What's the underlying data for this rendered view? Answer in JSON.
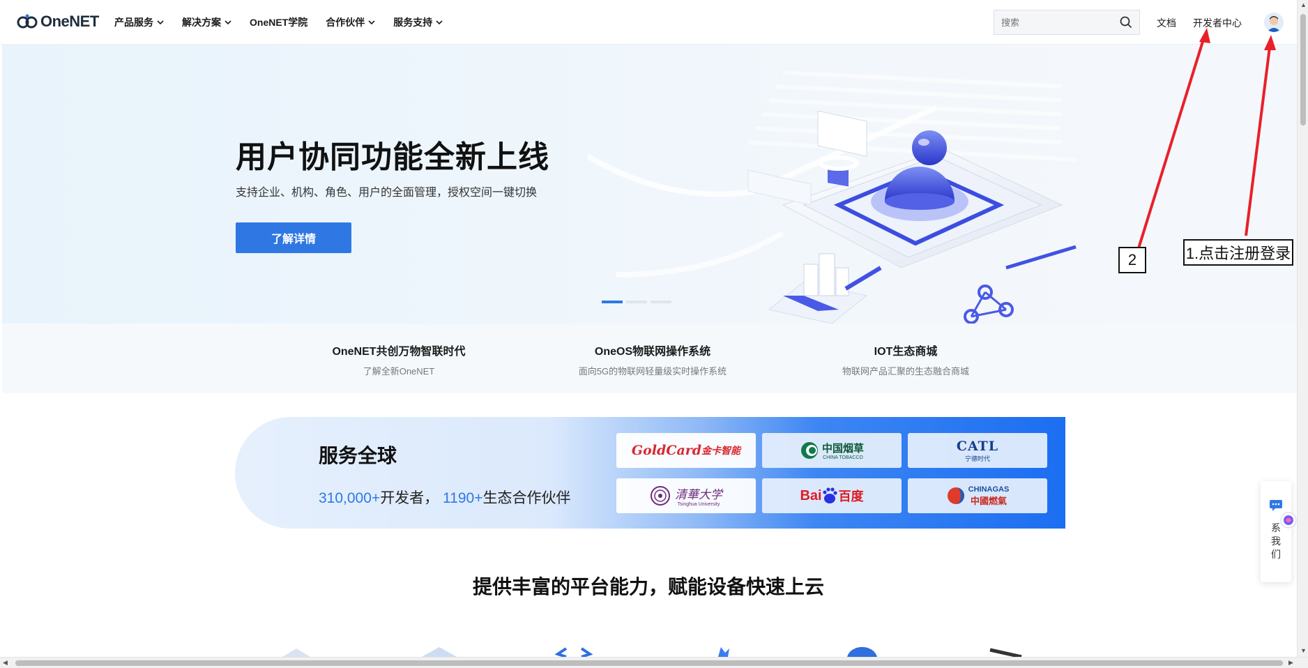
{
  "header": {
    "logo_text": "OneNET",
    "nav": [
      {
        "label": "产品服务",
        "dropdown": true
      },
      {
        "label": "解决方案",
        "dropdown": true
      },
      {
        "label": "OneNET学院",
        "dropdown": false
      },
      {
        "label": "合作伙伴",
        "dropdown": true
      },
      {
        "label": "服务支持",
        "dropdown": true
      }
    ],
    "search_placeholder": "搜索",
    "docs_label": "文档",
    "dev_center_label": "开发者中心"
  },
  "hero": {
    "title": "用户协同功能全新上线",
    "subtitle": "支持企业、机构、角色、用户的全面管理，授权空间一键切换",
    "button_label": "了解详情",
    "carousel_active": 1,
    "carousel_count": 3
  },
  "features": [
    {
      "title": "OneNET共创万物智联时代",
      "desc": "了解全新OneNET"
    },
    {
      "title": "OneOS物联网操作系统",
      "desc": "面向5G的物联网轻量级实时操作系统"
    },
    {
      "title": "IOT生态商城",
      "desc": "物联网产品汇聚的生态融合商城"
    }
  ],
  "service": {
    "title": "服务全球",
    "developers_num": "310,000+",
    "developers_label": "开发者，",
    "partners_num": "1190+",
    "partners_label": "生态合作伙伴",
    "partners": [
      {
        "name": "GoldCard金卡智能",
        "logo_text": "GoldCard",
        "logo_cn": "金卡智能"
      },
      {
        "name": "中国烟草",
        "logo_text": "中国烟草",
        "logo_sub": "CHINA TOBACCO"
      },
      {
        "name": "CATL 宁德时代",
        "logo_text": "CATL",
        "logo_sub": "宁德时代"
      },
      {
        "name": "清华大学",
        "logo_text": "清華大学",
        "logo_sub": "Tsinghua University"
      },
      {
        "name": "百度",
        "logo_text": "Bai",
        "logo_mid": "du",
        "logo_cn": "百度"
      },
      {
        "name": "CHINA GAS 中国燃气",
        "logo_text": "CHINAGAS",
        "logo_sub": "中國燃氣"
      }
    ]
  },
  "section_title": "提供丰富的平台能力，赋能设备快速上云",
  "annotations": [
    {
      "label": "1.点击注册登录"
    },
    {
      "label": "2"
    }
  ],
  "contact_widget": {
    "label": "联系我们",
    "visible_label": "系我们"
  },
  "colors": {
    "accent": "#2f78e4",
    "annotation_arrow": "#e8202a"
  }
}
